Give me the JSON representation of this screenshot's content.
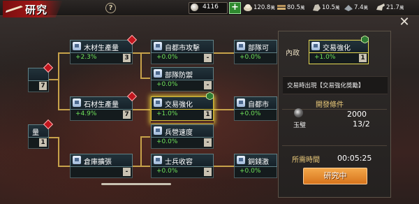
{
  "header": {
    "title": "研究",
    "help_symbol": "?",
    "silver": "4116",
    "add_symbol": "+",
    "resources": [
      {
        "icon": "food-icon",
        "value": "120.8",
        "unit": "萬"
      },
      {
        "icon": "wood-icon",
        "value": "80.5",
        "unit": "萬"
      },
      {
        "icon": "stone-icon",
        "value": "10.5",
        "unit": "萬"
      },
      {
        "icon": "iron-icon",
        "value": "7.4",
        "unit": "萬"
      },
      {
        "icon": "horse-icon",
        "value": "21.7",
        "unit": "萬"
      }
    ]
  },
  "nodes": [
    {
      "id": "left-top",
      "name": "",
      "pct": "",
      "level": "7"
    },
    {
      "id": "left-bot",
      "name": "量",
      "pct": "",
      "level": "1"
    },
    {
      "id": "wood",
      "name": "木材生產量",
      "pct": "+2.3%",
      "level": "3"
    },
    {
      "id": "stone",
      "name": "石材生產量",
      "pct": "+4.9%",
      "level": "7"
    },
    {
      "id": "warehouse",
      "name": "倉庫擴張",
      "pct": "",
      "level": "-"
    },
    {
      "id": "capital-attack",
      "name": "自都市攻擊",
      "pct": "+0.0%",
      "level": "-"
    },
    {
      "id": "troop-defense",
      "name": "部隊防禦",
      "pct": "+0.0%",
      "level": "-"
    },
    {
      "id": "trade",
      "name": "交易強化",
      "pct": "+1.0%",
      "level": "1"
    },
    {
      "id": "barracks-speed",
      "name": "兵營速度",
      "pct": "+0.0%",
      "level": "-"
    },
    {
      "id": "soldier-capacity",
      "name": "士兵收容",
      "pct": "+0.0%",
      "level": "-"
    },
    {
      "id": "troop-right",
      "name": "部隊可",
      "pct": "+0.0%",
      "level": ""
    },
    {
      "id": "capital-right",
      "name": "自都市",
      "pct": "+0.0%",
      "level": ""
    },
    {
      "id": "coin-right",
      "name": "銅錢激",
      "pct": "+0.0%",
      "level": ""
    }
  ],
  "panel": {
    "category": "內政",
    "node_name": "交易強化",
    "node_pct": "+1.0%",
    "node_level": "1",
    "description": "交易時出現【交易強化獎勵】",
    "conditions_title": "開發條件",
    "item_name": "玉璧",
    "required": "2000",
    "owned": "13/2",
    "time_label": "所需時間",
    "time_value": "00:05:25",
    "research_button": "研究中",
    "close_symbol": "✕"
  },
  "colors": {
    "positive": "#6fe35a",
    "accent_gold": "#e9db53",
    "button": "#e38a2b"
  }
}
